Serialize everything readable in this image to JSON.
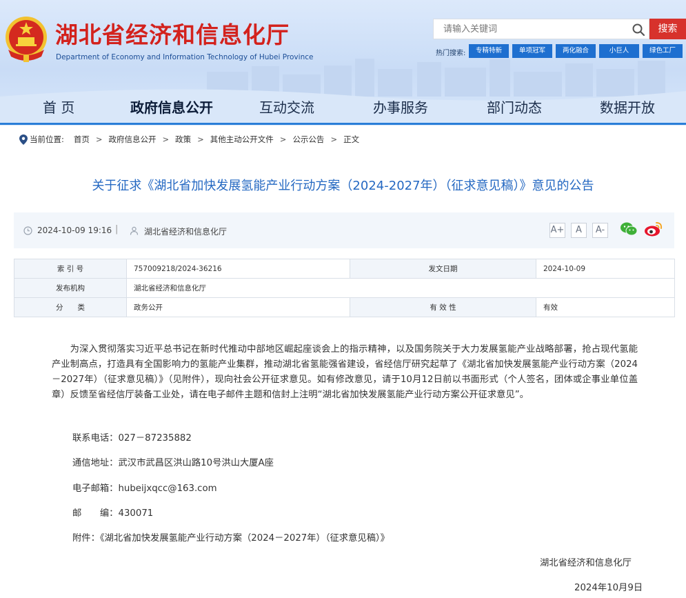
{
  "header": {
    "title": "湖北省经济和信息化厅",
    "subtitle": "Department of Economy and Information Technology of Hubei Province",
    "search_placeholder": "请输入关键词",
    "search_button": "搜索",
    "hot_label": "热门搜索:",
    "hot_tags": [
      "专精特新",
      "单项冠军",
      "两化融合",
      "小巨人",
      "绿色工厂"
    ]
  },
  "nav": {
    "items": [
      "首 页",
      "政府信息公开",
      "互动交流",
      "办事服务",
      "部门动态",
      "数据开放"
    ],
    "active_index": 1
  },
  "breadcrumb": {
    "label": "当前位置:",
    "items": [
      "首页",
      "政府信息公开",
      "政策",
      "其他主动公开文件",
      "公示公告",
      "正文"
    ],
    "separator": ">"
  },
  "article": {
    "title": "关于征求《湖北省加快发展氢能产业行动方案（2024-2027年）（征求意见稿）》意见的公告",
    "date": "2024-10-09 19:16",
    "meta_separator": "|",
    "source": "湖北省经济和信息化厅",
    "font_sizes": [
      "A+",
      "A",
      "A-"
    ]
  },
  "info_table": {
    "rows": [
      {
        "label1": "索 引 号",
        "value1": "757009218/2024-36216",
        "label2": "发文日期",
        "value2": "2024-10-09"
      },
      {
        "label1": "发布机构",
        "value1": "湖北省经济和信息化厅",
        "label2": "",
        "value2": ""
      },
      {
        "label1": "分　　类",
        "value1": "政务公开",
        "label2": "有 效 性",
        "value2": "有效"
      }
    ]
  },
  "body": {
    "paragraph": "为深入贯彻落实习近平总书记在新时代推动中部地区崛起座谈会上的指示精神，以及国务院关于大力发展氢能产业战略部署，抢占现代氢能产业制高点，打造具有全国影响力的氢能产业集群，推动湖北省氢能强省建设，省经信厅研究起草了《湖北省加快发展氢能产业行动方案（2024－2027年）（征求意见稿）》（见附件），现向社会公开征求意见。如有修改意见，请于10月12日前以书面形式（个人签名，团体或企事业单位盖章）反馈至省经信厅装备工业处，请在电子邮件主题和信封上注明“湖北省加快发展氢能产业行动方案公开征求意见”。",
    "phone": "联系电话：027－87235882",
    "address": "通信地址：武汉市武昌区洪山路10号洪山大厦A座",
    "email": "电子邮箱：hubeijxqcc@163.com",
    "postcode": "邮　　编：430071",
    "attachment": "附件：《湖北省加快发展氢能产业行动方案（2024－2027年）（征求意见稿）》",
    "signature": "湖北省经济和信息化厅",
    "sign_date": "2024年10月9日"
  },
  "colors": {
    "title_red": "#d3221d",
    "link_blue": "#2468c2",
    "accent_blue": "#1e6fd0",
    "search_red": "#d7322c"
  }
}
